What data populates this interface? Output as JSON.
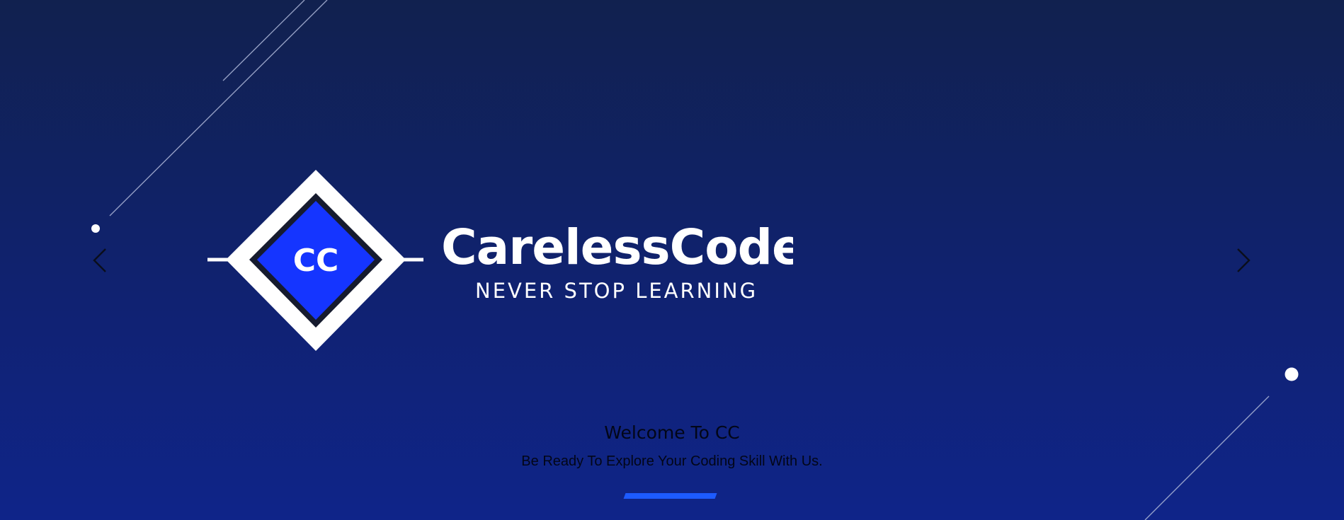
{
  "brand": {
    "monogram": "CC",
    "name": "CarelessCoder",
    "tagline": "NEVER STOP LEARNING"
  },
  "carousel": {
    "prev_icon": "chevron-left-icon",
    "next_icon": "chevron-right-icon",
    "slide": {
      "title": "Welcome To CC",
      "subtitle": "Be Ready To Explore Your Coding Skill With Us."
    },
    "indicators": [
      {
        "active": true
      }
    ]
  },
  "colors": {
    "background_top": "#11214f",
    "background_bottom": "#0f2489",
    "logo_blue": "#1535ff",
    "indicator_active": "#1d5bff",
    "caption_text": "#020617"
  }
}
